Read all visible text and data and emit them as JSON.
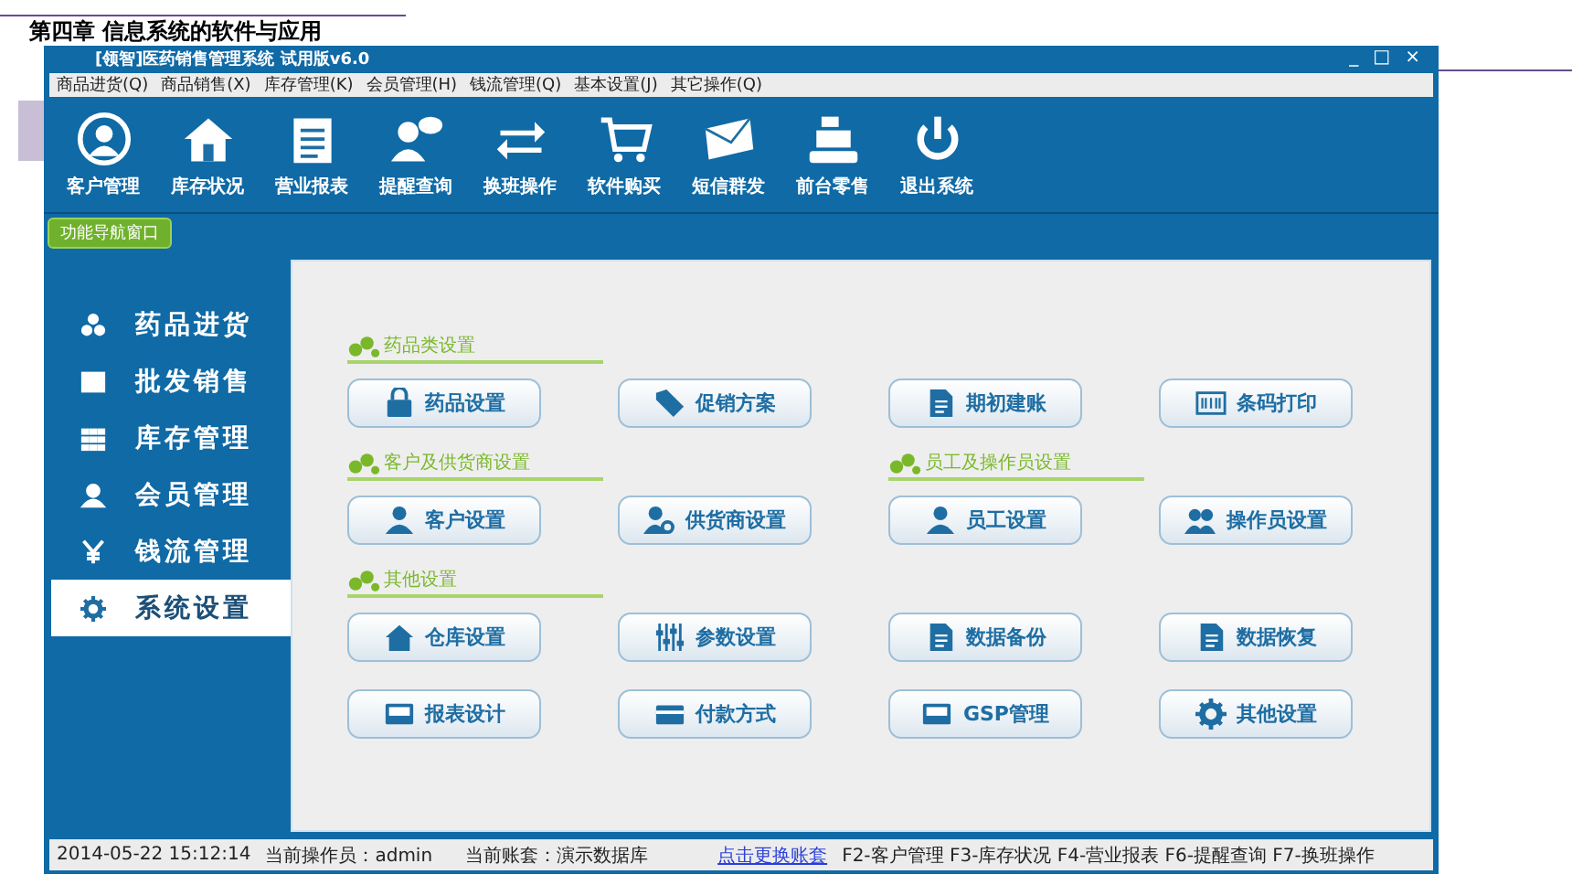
{
  "slide": {
    "title": "第四章  信息系统的软件与应用"
  },
  "window": {
    "title": "[领智]医药销售管理系统 试用版v6.0",
    "controls": [
      "_",
      "□",
      "×"
    ]
  },
  "menu": [
    "商品进货(Q)",
    "商品销售(X)",
    "库存管理(K)",
    "会员管理(H)",
    "钱流管理(Q)",
    "基本设置(J)",
    "其它操作(Q)"
  ],
  "toolbar": [
    "客户管理",
    "库存状况",
    "营业报表",
    "提醒查询",
    "换班操作",
    "软件购买",
    "短信群发",
    "前台零售",
    "退出系统"
  ],
  "nav_tab": "功能导航窗口",
  "sidebar": [
    {
      "label": "药品进货",
      "selected": false
    },
    {
      "label": "批发销售",
      "selected": false
    },
    {
      "label": "库存管理",
      "selected": false
    },
    {
      "label": "会员管理",
      "selected": false
    },
    {
      "label": "钱流管理",
      "selected": false
    },
    {
      "label": "系统设置",
      "selected": true
    }
  ],
  "content": [
    {
      "kind": "headings",
      "items": [
        "药品类设置"
      ]
    },
    {
      "kind": "buttons",
      "items": [
        "药品设置",
        "促销方案",
        "期初建账",
        "条码打印"
      ]
    },
    {
      "kind": "headings",
      "items": [
        "客户及供货商设置",
        "员工及操作员设置"
      ]
    },
    {
      "kind": "buttons",
      "items": [
        "客户设置",
        "供货商设置",
        "员工设置",
        "操作员设置"
      ]
    },
    {
      "kind": "headings",
      "items": [
        "其他设置"
      ]
    },
    {
      "kind": "buttons",
      "items": [
        "仓库设置",
        "参数设置",
        "数据备份",
        "数据恢复"
      ]
    },
    {
      "kind": "buttons",
      "items": [
        "报表设计",
        "付款方式",
        "GSP管理",
        "其他设置"
      ]
    }
  ],
  "status_bar": {
    "time": "2014-05-22 15:12:14",
    "operator": "当前操作员：admin",
    "account": "当前账套：演示数据库",
    "link": "点击更换账套",
    "shortcuts": "F2-客户管理 F3-库存状况 F4-营业报表 F6-提醒查询 F7-换班操作"
  }
}
